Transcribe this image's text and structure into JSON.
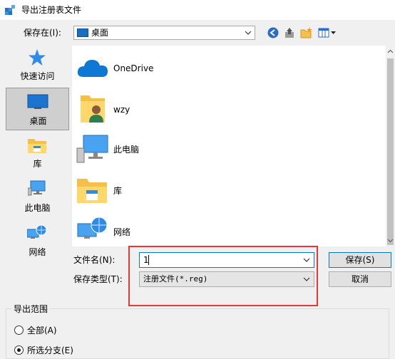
{
  "window": {
    "title": "导出注册表文件"
  },
  "savein": {
    "label": "保存在(I):",
    "value": "桌面"
  },
  "places": [
    {
      "label": "快速访问",
      "icon": "star-icon"
    },
    {
      "label": "桌面",
      "icon": "desktop-icon",
      "selected": true
    },
    {
      "label": "库",
      "icon": "library-icon"
    },
    {
      "label": "此电脑",
      "icon": "computer-icon"
    },
    {
      "label": "网络",
      "icon": "network-icon"
    }
  ],
  "files": [
    {
      "label": "OneDrive",
      "icon": "cloud-icon"
    },
    {
      "label": "wzy",
      "icon": "user-folder-icon"
    },
    {
      "label": "此电脑",
      "icon": "computer-icon"
    },
    {
      "label": "库",
      "icon": "library-icon"
    },
    {
      "label": "网络",
      "icon": "network-icon"
    }
  ],
  "filename": {
    "label": "文件名(N):",
    "value": "1"
  },
  "filetype": {
    "label": "保存类型(T):",
    "value": "注册文件(*.reg)"
  },
  "buttons": {
    "save": "保存(S)",
    "cancel": "取消"
  },
  "export_range": {
    "title": "导出范围",
    "options": [
      {
        "label": "全部(A)",
        "checked": false
      },
      {
        "label": "所选分支(E)",
        "checked": true
      }
    ]
  },
  "colors": {
    "highlight": "#e53935",
    "accent": "#0078d7"
  }
}
